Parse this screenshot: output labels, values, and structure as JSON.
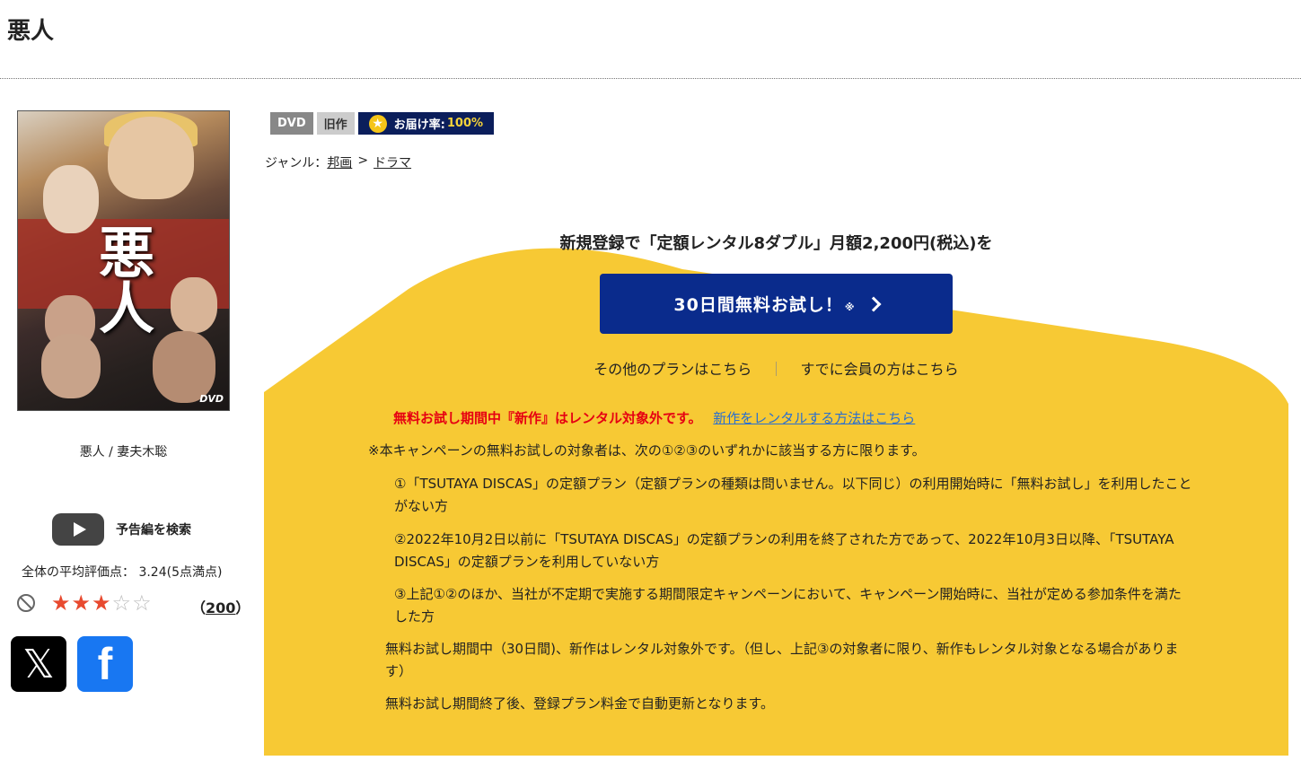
{
  "page": {
    "title": "悪人"
  },
  "poster": {
    "title_text": "悪人",
    "dvd_mark": "DVD"
  },
  "caption": "悪人 / 妻夫木聡",
  "trailer": {
    "label": "予告編を検索",
    "icon": "youtube-play-icon"
  },
  "rating": {
    "average_text": "全体の平均評価点： 3.24(5点満点)",
    "stars_on": 3,
    "stars_total": 5,
    "count_open": "（",
    "count": "200",
    "count_close": "）"
  },
  "social": {
    "x_label": "𝕏",
    "facebook_label": "f"
  },
  "badges": {
    "dvd": "DVD",
    "old": "旧作",
    "delivery_label": "お届け率:",
    "delivery_value": "100%"
  },
  "genre": {
    "label": "ジャンル：",
    "parent": "邦画",
    "separator": ">",
    "child": "ドラマ"
  },
  "promo": {
    "headline": "新規登録で「定額レンタル8ダブル」月額2,200円(税込)を",
    "button_label": "30日間無料お試し！",
    "button_mark": "※",
    "other_plans": "その他のプランはこちら",
    "divider": "｜",
    "members": "すでに会員の方はこちら",
    "warning": "無料お試し期間中『新作』はレンタル対象外です。",
    "warning_link": "新作をレンタルする方法はこちら",
    "notes": [
      "※本キャンペーンの無料お試しの対象者は、次の①②③のいずれかに該当する方に限ります。",
      "①「TSUTAYA DISCAS」の定額プラン（定額プランの種類は問いません。以下同じ）の利用開始時に「無料お試し」を利用したことがない方",
      "②2022年10月2日以前に「TSUTAYA DISCAS」の定額プランの利用を終了された方であって、2022年10月3日以降、「TSUTAYA DISCAS」の定額プランを利用していない方",
      "③上記①②のほか、当社が不定期で実施する期間限定キャンペーンにおいて、キャンペーン開始時に、当社が定める参加条件を満たした方",
      "無料お試し期間中（30日間)、新作はレンタル対象外です。（但し、上記③の対象者に限り、新作もレンタル対象となる場合があります）",
      "無料お試し期間終了後、登録プラン料金で自動更新となります。"
    ]
  },
  "colors": {
    "promo_yellow": "#f7c934",
    "button_blue": "#0a2b8c",
    "warning_red": "#e60012",
    "link_blue": "#2a6fcf"
  }
}
